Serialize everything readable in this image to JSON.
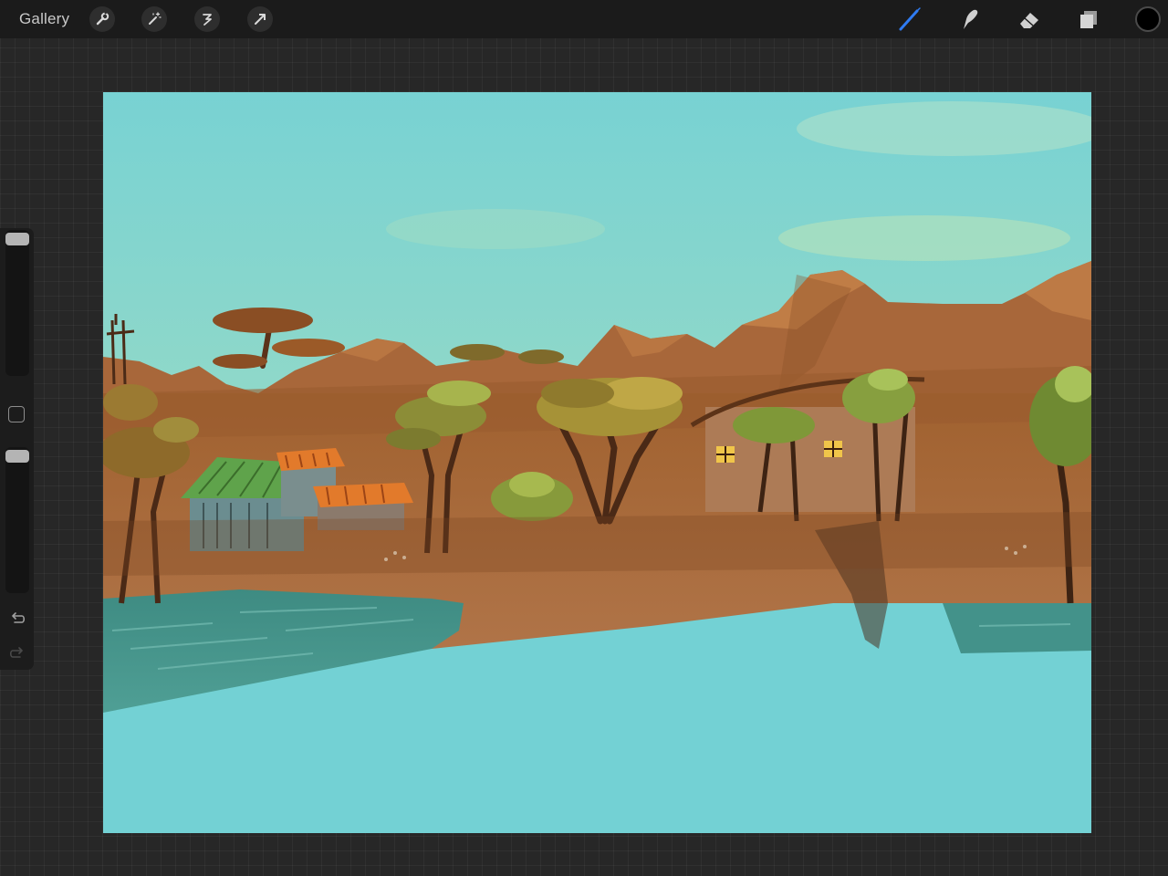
{
  "toolbar": {
    "gallery_label": "Gallery",
    "left_tools": [
      "wrench-icon",
      "magic-wand-icon",
      "selection-icon",
      "transform-arrow-icon"
    ],
    "right_tools": [
      "brush-icon",
      "smudge-icon",
      "eraser-icon",
      "layers-icon"
    ],
    "active_tool": "brush-icon",
    "accent_color": "#2f7bf2",
    "current_color": "#000000"
  },
  "sidebar": {
    "brush_size_level": 1.0,
    "opacity_level": 1.0,
    "icons": [
      "modify-square-icon",
      "undo-icon",
      "redo-icon"
    ]
  },
  "canvas": {
    "palette": {
      "sky": "#74d3d6",
      "sky_haze": "#c9e8b0",
      "mountain": "#a9683a",
      "ground": "#a8683b",
      "lake": "#72d1d4",
      "shore_water": "#3f8f86",
      "foliage": "#9db34a",
      "roof_green": "#5fa34b",
      "roof_orange": "#e27a2b"
    }
  }
}
